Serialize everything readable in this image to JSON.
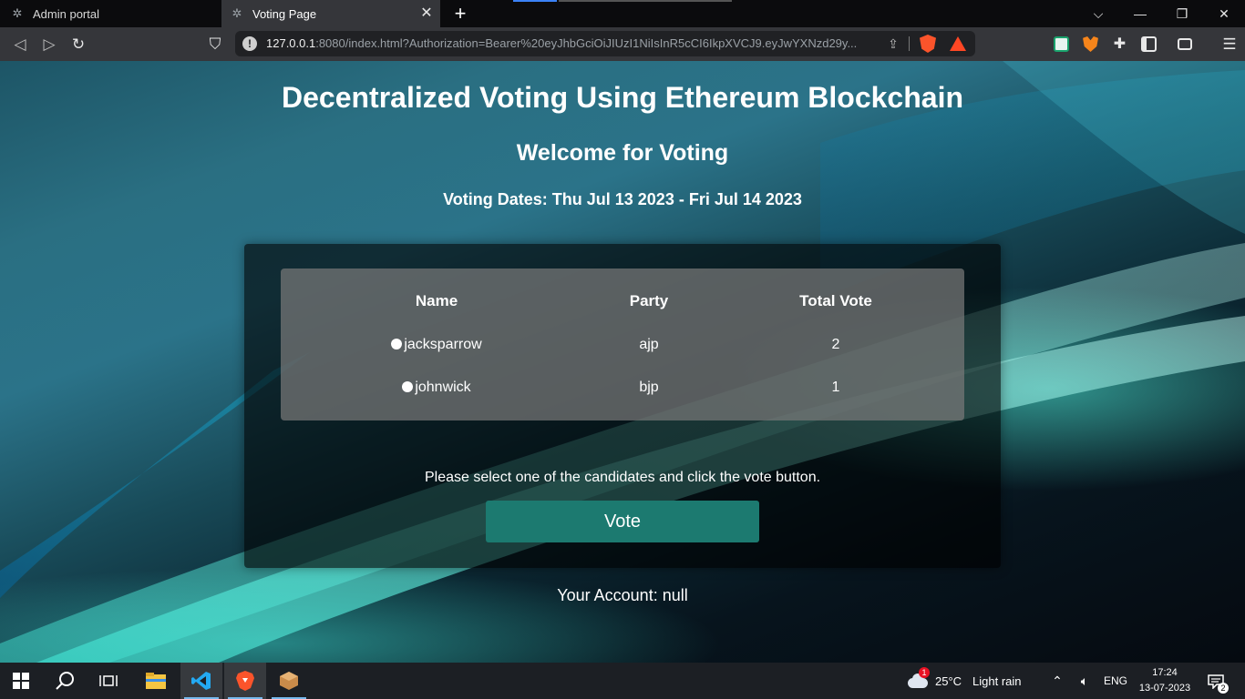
{
  "browser": {
    "tabs": [
      {
        "label": "Admin portal",
        "active": false
      },
      {
        "label": "Voting Page",
        "active": true
      }
    ],
    "url": {
      "host": "127.0.0.1",
      "rest": ":8080/index.html?Authorization=Bearer%20eyJhbGciOiJIUzI1NiIsInR5cCI6IkpXVCJ9.eyJwYXNzd29y..."
    }
  },
  "page": {
    "title": "Decentralized Voting Using Ethereum Blockchain",
    "welcome": "Welcome for Voting",
    "voting_dates": "Voting Dates: Thu Jul 13 2023 - Fri Jul 14 2023",
    "table": {
      "headers": [
        "Name",
        "Party",
        "Total Vote"
      ],
      "rows": [
        {
          "name": "jacksparrow",
          "party": "ajp",
          "votes": "2"
        },
        {
          "name": "johnwick",
          "party": "bjp",
          "votes": "1"
        }
      ]
    },
    "instruction": "Please select one of the candidates and click the vote button.",
    "vote_button": "Vote",
    "account": "Your Account: null"
  },
  "taskbar": {
    "weather_temp": "25°C",
    "weather_desc": "Light rain",
    "weather_badge": "1",
    "language": "ENG",
    "time": "17:24",
    "date": "13-07-2023",
    "notification_count": "2"
  }
}
